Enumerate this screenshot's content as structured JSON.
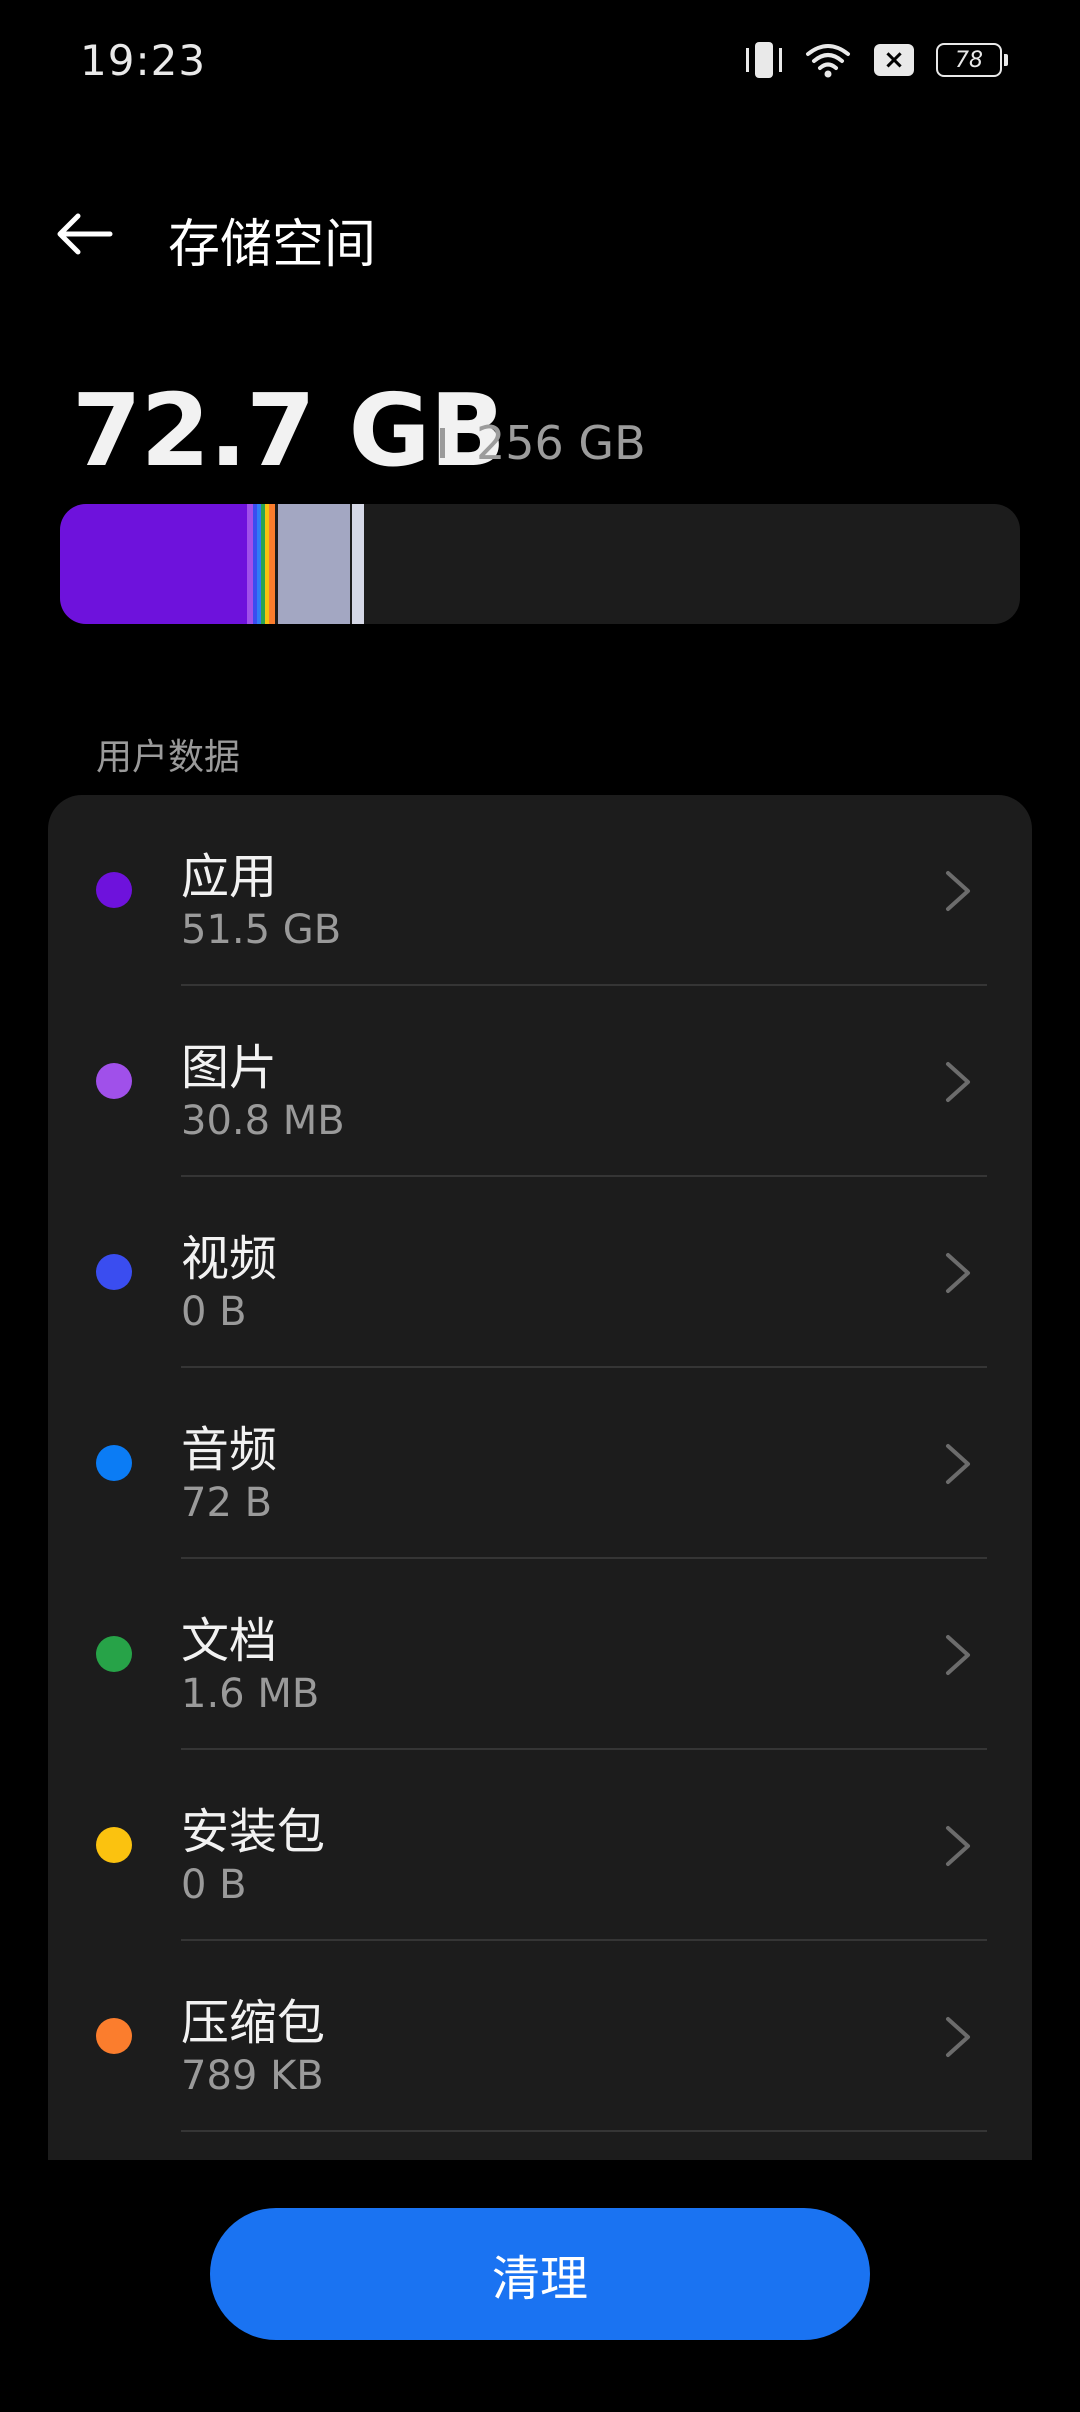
{
  "status_bar": {
    "time": "19:23",
    "battery": "78",
    "sim_icon": "×"
  },
  "header": {
    "title": "存储空间"
  },
  "summary": {
    "used": "72.7 GB",
    "total": "256 GB",
    "used_fraction": 0.284
  },
  "usage_segments": [
    {
      "name": "apps",
      "color": "#6e12dc"
    },
    {
      "name": "images",
      "color": "#a050ea"
    },
    {
      "name": "video",
      "color": "#3a4df0"
    },
    {
      "name": "audio",
      "color": "#2f7cf6"
    },
    {
      "name": "docs",
      "color": "#2aa44f"
    },
    {
      "name": "apk",
      "color": "#f6c20f"
    },
    {
      "name": "archive",
      "color": "#fb7d2d"
    },
    {
      "name": "other",
      "color": "#a3a7c2"
    },
    {
      "name": "system",
      "color": "#d5d8e6"
    }
  ],
  "section_label": "用户数据",
  "categories": [
    {
      "label": "应用",
      "size": "51.5 GB",
      "color": "#6e12dc"
    },
    {
      "label": "图片",
      "size": "30.8 MB",
      "color": "#a050ea"
    },
    {
      "label": "视频",
      "size": "0 B",
      "color": "#3a4df0"
    },
    {
      "label": "音频",
      "size": "72 B",
      "color": "#0b7cf5"
    },
    {
      "label": "文档",
      "size": "1.6 MB",
      "color": "#27a348"
    },
    {
      "label": "安装包",
      "size": "0 B",
      "color": "#fbc20f"
    },
    {
      "label": "压缩包",
      "size": "789 KB",
      "color": "#fb7d2d"
    }
  ],
  "clean_button": "清理"
}
